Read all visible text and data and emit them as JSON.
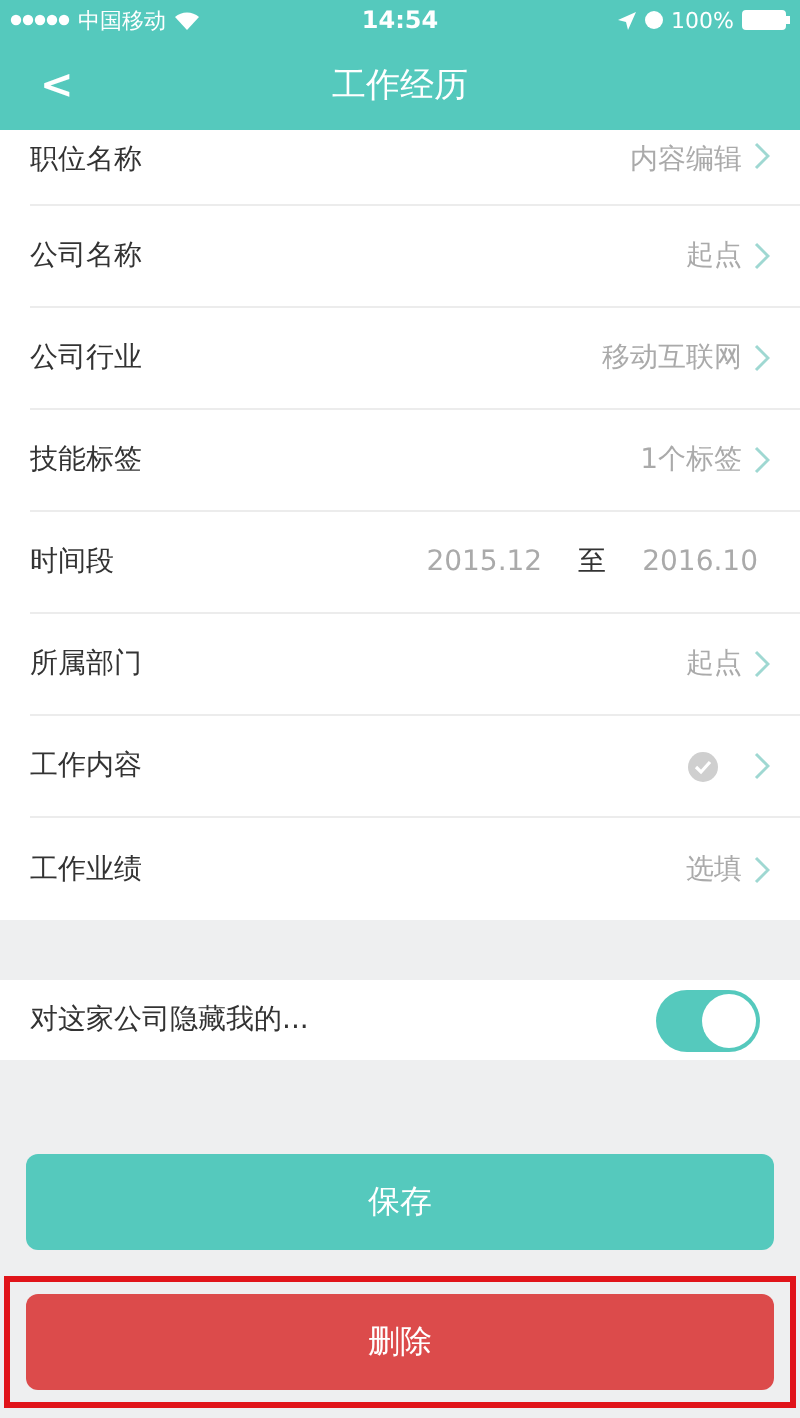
{
  "status_bar": {
    "carrier": "中国移动",
    "time": "14:54",
    "battery": "100%"
  },
  "nav": {
    "back": "<",
    "title": "工作经历"
  },
  "rows": [
    {
      "kind": "value",
      "label": "职位名称",
      "value": "内容编辑"
    },
    {
      "kind": "value",
      "label": "公司名称",
      "value": "起点"
    },
    {
      "kind": "value",
      "label": "公司行业",
      "value": "移动互联网"
    },
    {
      "kind": "value",
      "label": "技能标签",
      "value": "1个标签"
    },
    {
      "kind": "range",
      "label": "时间段",
      "from": "2015.12",
      "sep": "至",
      "to": "2016.10"
    },
    {
      "kind": "value",
      "label": "所属部门",
      "value": "起点"
    },
    {
      "kind": "check",
      "label": "工作内容"
    },
    {
      "kind": "value",
      "label": "工作业绩",
      "value": "选填"
    }
  ],
  "hide_toggle": {
    "label": "对这家公司隐藏我的...",
    "on": true
  },
  "buttons": [
    {
      "kind": "save",
      "label": "保存",
      "highlighted": false
    },
    {
      "kind": "delete",
      "label": "删除",
      "highlighted": true
    }
  ]
}
